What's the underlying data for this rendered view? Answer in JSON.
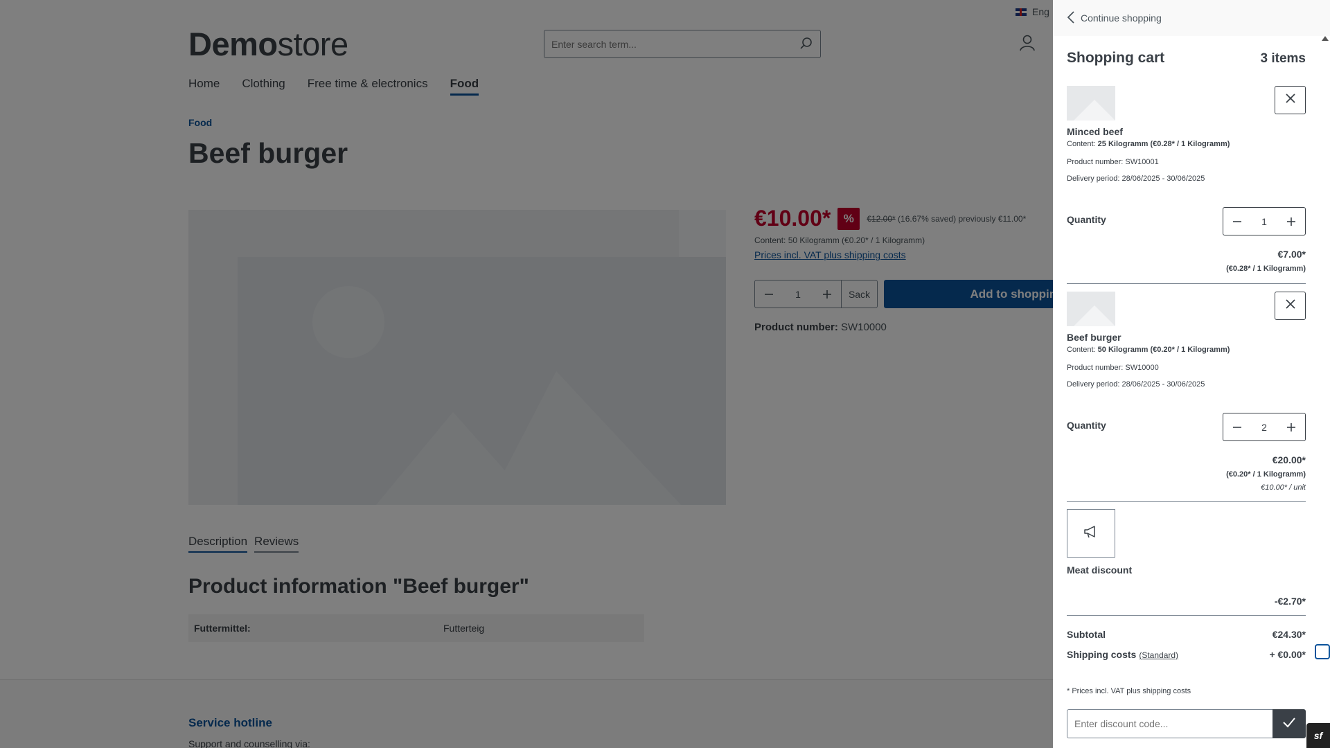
{
  "header": {
    "logo_bold": "Demo",
    "logo_light": "store",
    "search_placeholder": "Enter search term...",
    "language": "Eng"
  },
  "nav": {
    "items": [
      "Home",
      "Clothing",
      "Free time & electronics",
      "Food"
    ],
    "active": "Food"
  },
  "breadcrumb": "Food",
  "product": {
    "title": "Beef burger",
    "price": "€10.00*",
    "badge": "%",
    "list_price": "€12.00*",
    "saved": "(16.67% saved)",
    "previously": "previously €11.00*",
    "content": "Content: 50 Kilogramm (€0.20* / 1 Kilogramm)",
    "vat_link": "Prices incl. VAT plus shipping costs",
    "quantity": "1",
    "unit": "Sack",
    "add_to_cart": "Add to shopping cart",
    "number_label": "Product number:",
    "number": "SW10000"
  },
  "tabs": [
    "Description",
    "Reviews"
  ],
  "product_info_title": "Product information \"Beef burger\"",
  "properties": {
    "key": "Futtermittel:",
    "value": "Futterteig"
  },
  "footer": {
    "hotline": "Service hotline",
    "support": "Support and counselling via:"
  },
  "cart": {
    "continue": "Continue shopping",
    "title": "Shopping cart",
    "count": "3 items",
    "items": [
      {
        "name": "Minced beef",
        "content_label": "Content:",
        "content_value": "25 Kilogramm (€0.28* / 1 Kilogramm)",
        "product_number": "Product number: SW10001",
        "delivery": "Delivery period: 28/06/2025 - 30/06/2025",
        "quantity_label": "Quantity",
        "quantity": "1",
        "total": "€7.00*",
        "unit_price": "(€0.28* / 1 Kilogramm)"
      },
      {
        "name": "Beef burger",
        "content_label": "Content:",
        "content_value": "50 Kilogramm (€0.20* / 1 Kilogramm)",
        "product_number": "Product number: SW10000",
        "delivery": "Delivery period: 28/06/2025 - 30/06/2025",
        "quantity_label": "Quantity",
        "quantity": "2",
        "total": "€20.00*",
        "unit_price": "(€0.20* / 1 Kilogramm)",
        "per_unit": "€10.00* / unit"
      }
    ],
    "discount": {
      "name": "Meat discount",
      "amount": "-€2.70*"
    },
    "subtotal_label": "Subtotal",
    "subtotal": "€24.30*",
    "shipping_label": "Shipping costs",
    "shipping_method": "(Standard)",
    "shipping": "+ €0.00*",
    "note": "* Prices incl. VAT plus shipping costs",
    "promo_placeholder": "Enter discount code..."
  },
  "colors": {
    "accent": "#0b539b",
    "sale": "#c3002b",
    "text": "#3a4047"
  }
}
